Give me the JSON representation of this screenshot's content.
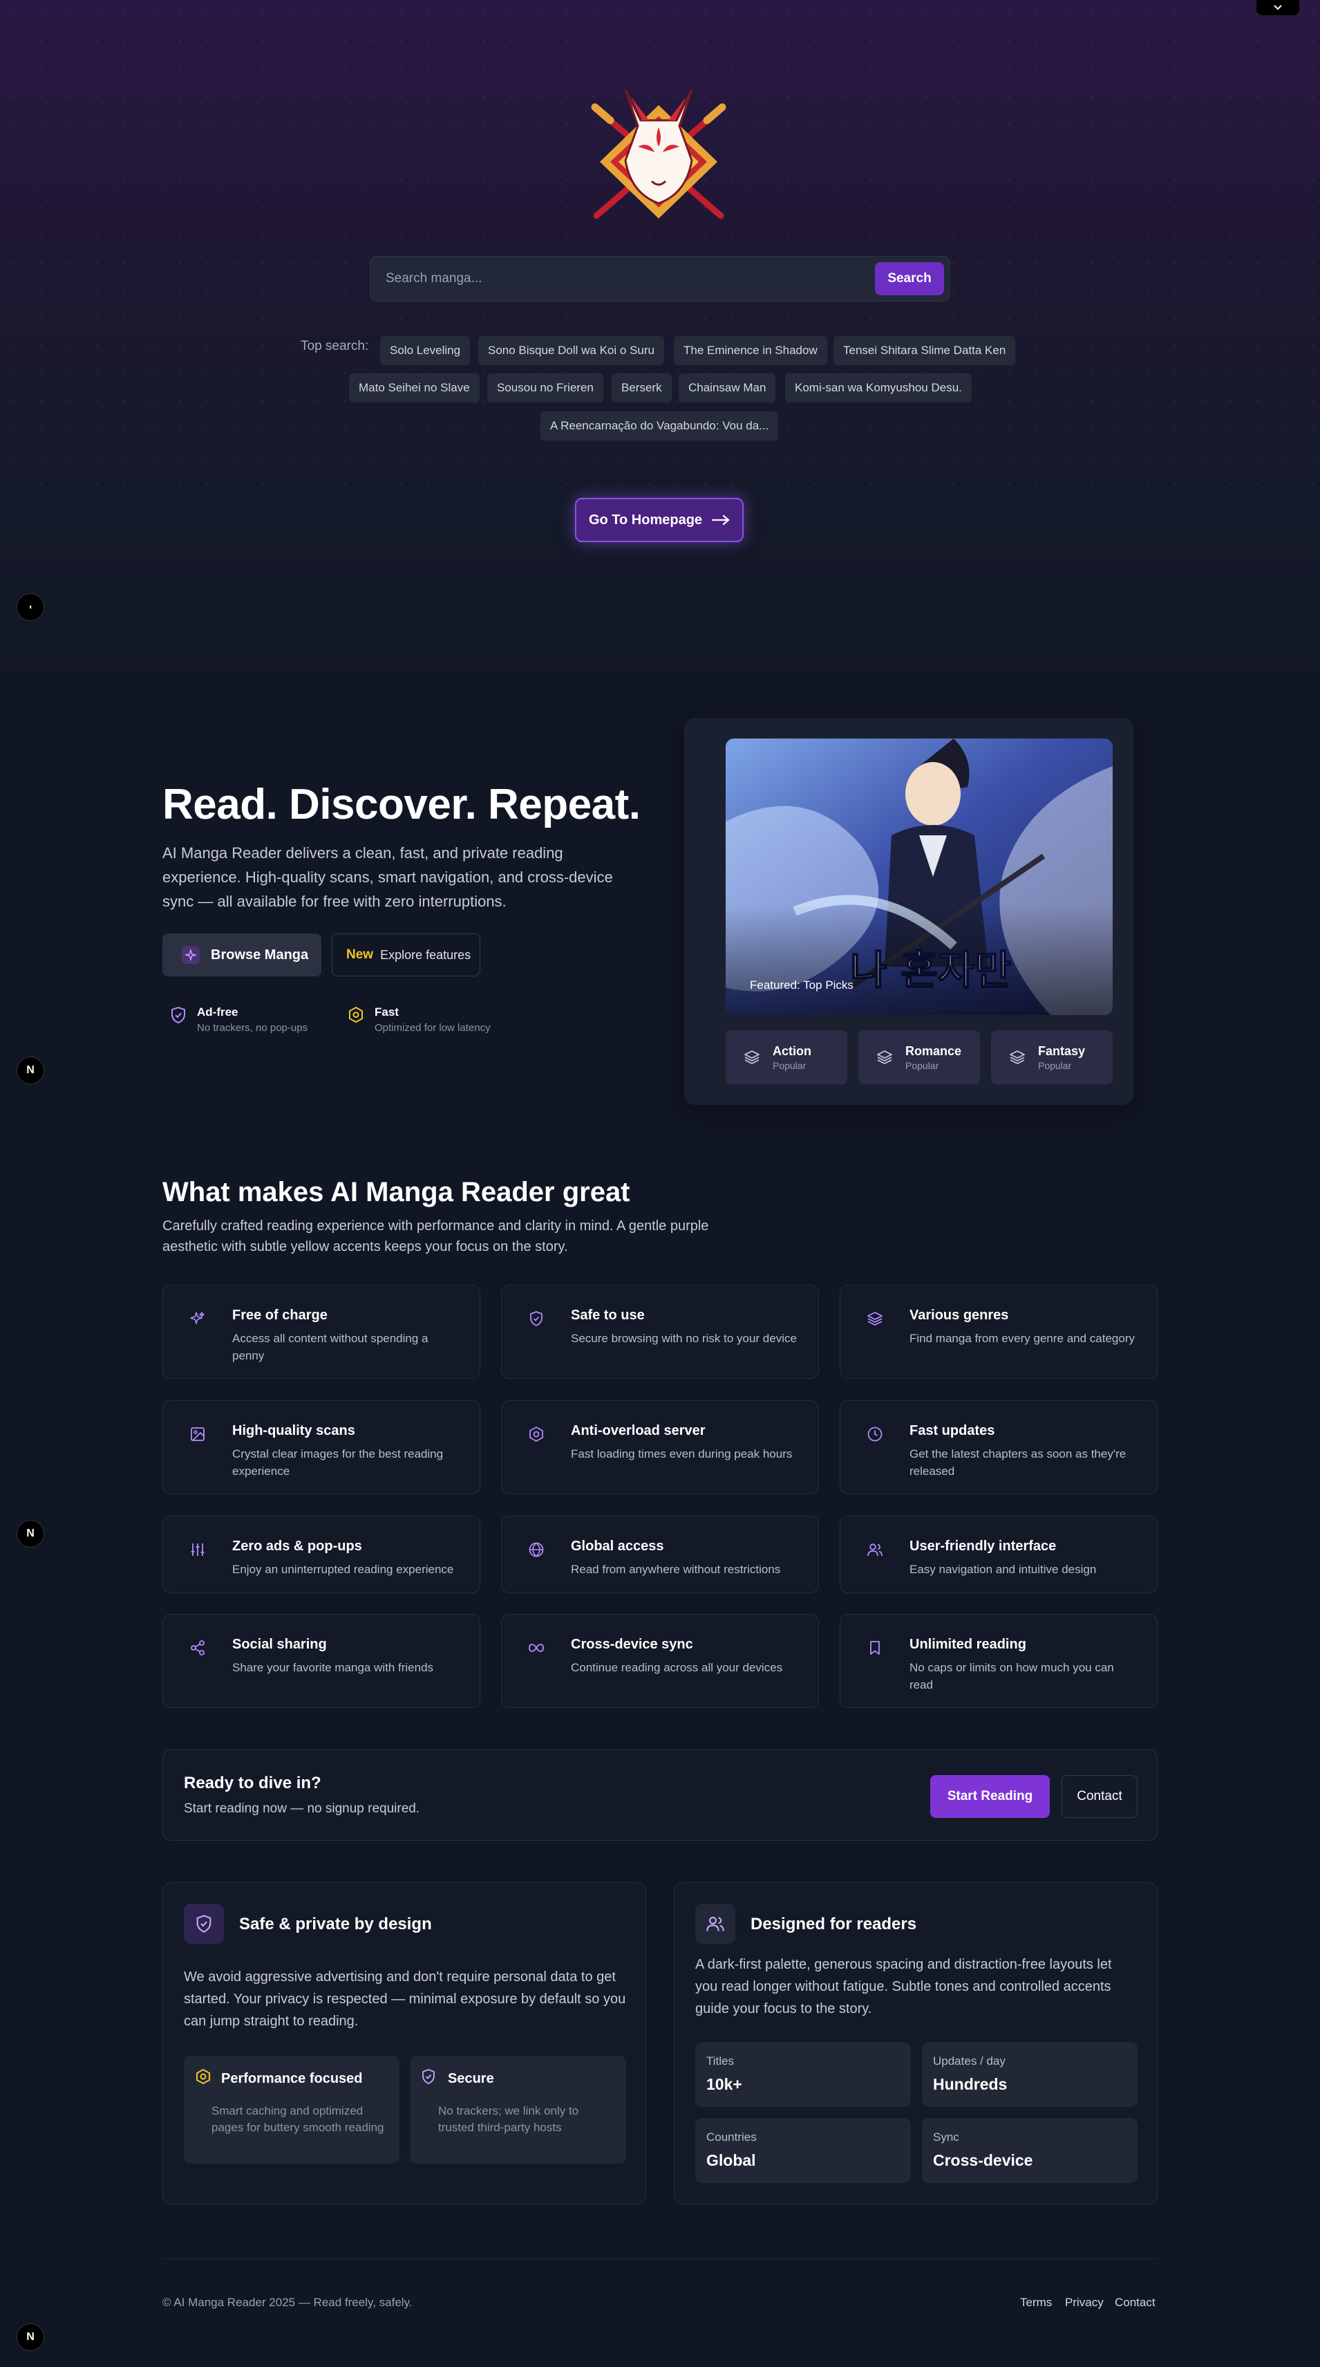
{
  "search": {
    "placeholder": "Search manga...",
    "button": "Search",
    "top_label": "Top search:",
    "top_items": [
      "Solo Leveling",
      "Sono Bisque Doll wa Koi o Suru",
      "The Eminence in Shadow",
      "Tensei Shitara Slime Datta Ken",
      "Mato Seihei no Slave",
      "Sousou no Frieren",
      "Berserk",
      "Chainsaw Man",
      "Komi-san wa Komyushou Desu.",
      "A Reencarnação do Vagabundo: Vou da..."
    ]
  },
  "home_button": "Go To Homepage",
  "hero": {
    "title": "Read. Discover. Repeat.",
    "description": "AI Manga Reader delivers a clean, fast, and private reading experience. High-quality scans, smart navigation, and cross-device sync — all available for free with zero interruptions.",
    "browse_button": "Browse Manga",
    "new_tag": "New",
    "explore_button": "Explore features",
    "mini_features": [
      {
        "title": "Ad-free",
        "sub": "No trackers, no pop-ups"
      },
      {
        "title": "Fast",
        "sub": "Optimized for low latency"
      }
    ]
  },
  "featured": {
    "caption": "Featured: Top Picks",
    "genres": [
      {
        "title": "Action",
        "sub": "Popular"
      },
      {
        "title": "Romance",
        "sub": "Popular"
      },
      {
        "title": "Fantasy",
        "sub": "Popular"
      }
    ]
  },
  "features_section": {
    "title": "What makes AI Manga Reader great",
    "subtitle": "Carefully crafted reading experience with performance and clarity in mind. A gentle purple aesthetic with subtle yellow accents keeps your focus on the story.",
    "items": [
      {
        "icon": "sparkles-icon",
        "title": "Free of charge",
        "desc": "Access all content without spending a penny"
      },
      {
        "icon": "shield-icon",
        "title": "Safe to use",
        "desc": "Secure browsing with no risk to your device"
      },
      {
        "icon": "layers-icon",
        "title": "Various genres",
        "desc": "Find manga from every genre and category"
      },
      {
        "icon": "image-icon",
        "title": "High-quality scans",
        "desc": "Crystal clear images for the best reading experience"
      },
      {
        "icon": "hexagon-icon",
        "title": "Anti-overload server",
        "desc": "Fast loading times even during peak hours"
      },
      {
        "icon": "clock-icon",
        "title": "Fast updates",
        "desc": "Get the latest chapters as soon as they're released"
      },
      {
        "icon": "sliders-icon",
        "title": "Zero ads & pop-ups",
        "desc": "Enjoy an uninterrupted reading experience"
      },
      {
        "icon": "globe-icon",
        "title": "Global access",
        "desc": "Read from anywhere without restrictions"
      },
      {
        "icon": "users-icon",
        "title": "User-friendly interface",
        "desc": "Easy navigation and intuitive design"
      },
      {
        "icon": "share-icon",
        "title": "Social sharing",
        "desc": "Share your favorite manga with friends"
      },
      {
        "icon": "infinity-icon",
        "title": "Cross-device sync",
        "desc": "Continue reading across all your devices"
      },
      {
        "icon": "bookmark-icon",
        "title": "Unlimited reading",
        "desc": "No caps or limits on how much you can read"
      }
    ]
  },
  "cta": {
    "title": "Ready to dive in?",
    "subtitle": "Start reading now — no signup required.",
    "start_button": "Start Reading",
    "contact_button": "Contact"
  },
  "privacy_card": {
    "title": "Safe & private by design",
    "description": "We avoid aggressive advertising and don't require personal data to get started. Your privacy is respected — minimal exposure by default so you can jump straight to reading.",
    "perf": {
      "title": "Performance focused",
      "desc": "Smart caching and optimized pages for buttery smooth reading"
    },
    "secure": {
      "title": "Secure",
      "desc": "No trackers; we link only to trusted third-party hosts"
    }
  },
  "readers_card": {
    "title": "Designed for readers",
    "description": "A dark-first palette, generous spacing and distraction-free layouts let you read longer without fatigue. Subtle tones and controlled accents guide your focus to the story.",
    "stats": [
      {
        "label": "Titles",
        "value": "10k+"
      },
      {
        "label": "Updates / day",
        "value": "Hundreds"
      },
      {
        "label": "Countries",
        "value": "Global"
      },
      {
        "label": "Sync",
        "value": "Cross-device"
      }
    ]
  },
  "footer": {
    "copyright": "© AI Manga Reader 2025 — Read freely, safely.",
    "links": [
      "Terms",
      "Privacy",
      "Contact"
    ]
  },
  "colors": {
    "accent": "#7f35d6",
    "accent_dark": "#6d2fc3",
    "highlight": "#f2c624",
    "background": "#111624"
  }
}
